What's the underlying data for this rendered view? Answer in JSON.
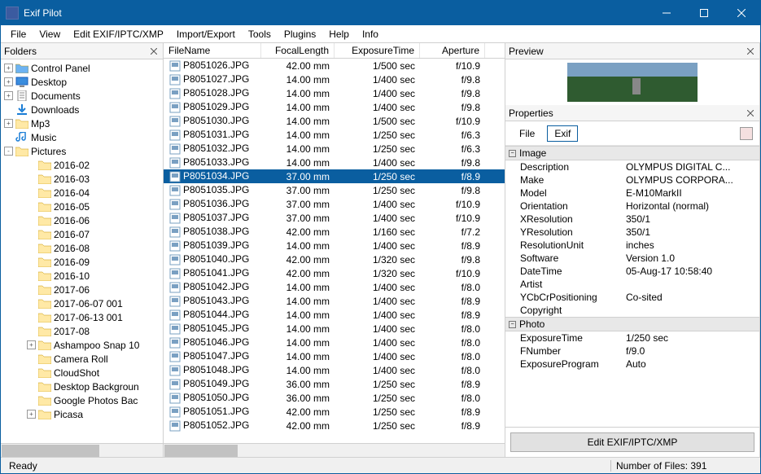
{
  "titlebar": {
    "title": "Exif Pilot"
  },
  "menus": [
    "File",
    "View",
    "Edit EXIF/IPTC/XMP",
    "Import/Export",
    "Tools",
    "Plugins",
    "Help",
    "Info"
  ],
  "panes": {
    "folders": "Folders",
    "preview": "Preview",
    "properties": "Properties"
  },
  "tree": [
    {
      "indent": 0,
      "exp": "+",
      "icon": "folder-blue",
      "label": "Control Panel"
    },
    {
      "indent": 0,
      "exp": "+",
      "icon": "desktop",
      "label": "Desktop"
    },
    {
      "indent": 0,
      "exp": "+",
      "icon": "documents",
      "label": "Documents"
    },
    {
      "indent": 0,
      "exp": "",
      "icon": "downloads",
      "label": "Downloads"
    },
    {
      "indent": 0,
      "exp": "+",
      "icon": "folder",
      "label": "Mp3"
    },
    {
      "indent": 0,
      "exp": "",
      "icon": "music",
      "label": "Music"
    },
    {
      "indent": 0,
      "exp": "-",
      "icon": "folder",
      "label": "Pictures"
    },
    {
      "indent": 1,
      "exp": "",
      "icon": "folder",
      "label": "2016-02"
    },
    {
      "indent": 1,
      "exp": "",
      "icon": "folder",
      "label": "2016-03"
    },
    {
      "indent": 1,
      "exp": "",
      "icon": "folder",
      "label": "2016-04"
    },
    {
      "indent": 1,
      "exp": "",
      "icon": "folder",
      "label": "2016-05"
    },
    {
      "indent": 1,
      "exp": "",
      "icon": "folder",
      "label": "2016-06"
    },
    {
      "indent": 1,
      "exp": "",
      "icon": "folder",
      "label": "2016-07"
    },
    {
      "indent": 1,
      "exp": "",
      "icon": "folder",
      "label": "2016-08"
    },
    {
      "indent": 1,
      "exp": "",
      "icon": "folder",
      "label": "2016-09"
    },
    {
      "indent": 1,
      "exp": "",
      "icon": "folder",
      "label": "2016-10"
    },
    {
      "indent": 1,
      "exp": "",
      "icon": "folder",
      "label": "2017-06"
    },
    {
      "indent": 1,
      "exp": "",
      "icon": "folder",
      "label": "2017-06-07 001"
    },
    {
      "indent": 1,
      "exp": "",
      "icon": "folder",
      "label": "2017-06-13 001"
    },
    {
      "indent": 1,
      "exp": "",
      "icon": "folder",
      "label": "2017-08"
    },
    {
      "indent": 1,
      "exp": "+",
      "icon": "folder",
      "label": "Ashampoo Snap 10"
    },
    {
      "indent": 1,
      "exp": "",
      "icon": "folder",
      "label": "Camera Roll"
    },
    {
      "indent": 1,
      "exp": "",
      "icon": "folder",
      "label": "CloudShot"
    },
    {
      "indent": 1,
      "exp": "",
      "icon": "folder",
      "label": "Desktop Backgroun"
    },
    {
      "indent": 1,
      "exp": "",
      "icon": "folder",
      "label": "Google Photos Bac"
    },
    {
      "indent": 1,
      "exp": "+",
      "icon": "folder",
      "label": "Picasa"
    }
  ],
  "columns": {
    "name": "FileName",
    "focal": "FocalLength",
    "exposure": "ExposureTime",
    "aperture": "Aperture"
  },
  "files": [
    {
      "name": "P8051026.JPG",
      "focal": "42.00 mm",
      "exp": "1/500 sec",
      "ap": "f/10.9"
    },
    {
      "name": "P8051027.JPG",
      "focal": "14.00 mm",
      "exp": "1/400 sec",
      "ap": "f/9.8"
    },
    {
      "name": "P8051028.JPG",
      "focal": "14.00 mm",
      "exp": "1/400 sec",
      "ap": "f/9.8"
    },
    {
      "name": "P8051029.JPG",
      "focal": "14.00 mm",
      "exp": "1/400 sec",
      "ap": "f/9.8"
    },
    {
      "name": "P8051030.JPG",
      "focal": "14.00 mm",
      "exp": "1/500 sec",
      "ap": "f/10.9"
    },
    {
      "name": "P8051031.JPG",
      "focal": "14.00 mm",
      "exp": "1/250 sec",
      "ap": "f/6.3"
    },
    {
      "name": "P8051032.JPG",
      "focal": "14.00 mm",
      "exp": "1/250 sec",
      "ap": "f/6.3"
    },
    {
      "name": "P8051033.JPG",
      "focal": "14.00 mm",
      "exp": "1/400 sec",
      "ap": "f/9.8"
    },
    {
      "name": "P8051034.JPG",
      "focal": "37.00 mm",
      "exp": "1/250 sec",
      "ap": "f/8.9",
      "selected": true
    },
    {
      "name": "P8051035.JPG",
      "focal": "37.00 mm",
      "exp": "1/250 sec",
      "ap": "f/9.8"
    },
    {
      "name": "P8051036.JPG",
      "focal": "37.00 mm",
      "exp": "1/400 sec",
      "ap": "f/10.9"
    },
    {
      "name": "P8051037.JPG",
      "focal": "37.00 mm",
      "exp": "1/400 sec",
      "ap": "f/10.9"
    },
    {
      "name": "P8051038.JPG",
      "focal": "42.00 mm",
      "exp": "1/160 sec",
      "ap": "f/7.2"
    },
    {
      "name": "P8051039.JPG",
      "focal": "14.00 mm",
      "exp": "1/400 sec",
      "ap": "f/8.9"
    },
    {
      "name": "P8051040.JPG",
      "focal": "42.00 mm",
      "exp": "1/320 sec",
      "ap": "f/9.8"
    },
    {
      "name": "P8051041.JPG",
      "focal": "42.00 mm",
      "exp": "1/320 sec",
      "ap": "f/10.9"
    },
    {
      "name": "P8051042.JPG",
      "focal": "14.00 mm",
      "exp": "1/400 sec",
      "ap": "f/8.0"
    },
    {
      "name": "P8051043.JPG",
      "focal": "14.00 mm",
      "exp": "1/400 sec",
      "ap": "f/8.9"
    },
    {
      "name": "P8051044.JPG",
      "focal": "14.00 mm",
      "exp": "1/400 sec",
      "ap": "f/8.9"
    },
    {
      "name": "P8051045.JPG",
      "focal": "14.00 mm",
      "exp": "1/400 sec",
      "ap": "f/8.0"
    },
    {
      "name": "P8051046.JPG",
      "focal": "14.00 mm",
      "exp": "1/400 sec",
      "ap": "f/8.0"
    },
    {
      "name": "P8051047.JPG",
      "focal": "14.00 mm",
      "exp": "1/400 sec",
      "ap": "f/8.0"
    },
    {
      "name": "P8051048.JPG",
      "focal": "14.00 mm",
      "exp": "1/400 sec",
      "ap": "f/8.0"
    },
    {
      "name": "P8051049.JPG",
      "focal": "36.00 mm",
      "exp": "1/250 sec",
      "ap": "f/8.9"
    },
    {
      "name": "P8051050.JPG",
      "focal": "36.00 mm",
      "exp": "1/250 sec",
      "ap": "f/8.0"
    },
    {
      "name": "P8051051.JPG",
      "focal": "42.00 mm",
      "exp": "1/250 sec",
      "ap": "f/8.9"
    },
    {
      "name": "P8051052.JPG",
      "focal": "42.00 mm",
      "exp": "1/250 sec",
      "ap": "f/8.9"
    }
  ],
  "propsTabs": {
    "file": "File",
    "exif": "Exif"
  },
  "propGroups": [
    {
      "name": "Image",
      "rows": [
        {
          "k": "Description",
          "v": "OLYMPUS DIGITAL C..."
        },
        {
          "k": "Make",
          "v": "OLYMPUS CORPORA..."
        },
        {
          "k": "Model",
          "v": "E-M10MarkII"
        },
        {
          "k": "Orientation",
          "v": "Horizontal (normal)"
        },
        {
          "k": "XResolution",
          "v": "350/1"
        },
        {
          "k": "YResolution",
          "v": "350/1"
        },
        {
          "k": "ResolutionUnit",
          "v": "inches"
        },
        {
          "k": "Software",
          "v": "Version 1.0"
        },
        {
          "k": "DateTime",
          "v": "05-Aug-17 10:58:40"
        },
        {
          "k": "Artist",
          "v": ""
        },
        {
          "k": "YCbCrPositioning",
          "v": "Co-sited"
        },
        {
          "k": "Copyright",
          "v": ""
        }
      ]
    },
    {
      "name": "Photo",
      "rows": [
        {
          "k": "ExposureTime",
          "v": "1/250 sec"
        },
        {
          "k": "FNumber",
          "v": "f/9.0"
        },
        {
          "k": "ExposureProgram",
          "v": "Auto"
        }
      ]
    }
  ],
  "editButton": "Edit EXIF/IPTC/XMP",
  "status": {
    "ready": "Ready",
    "files": "Number of Files: 391"
  }
}
